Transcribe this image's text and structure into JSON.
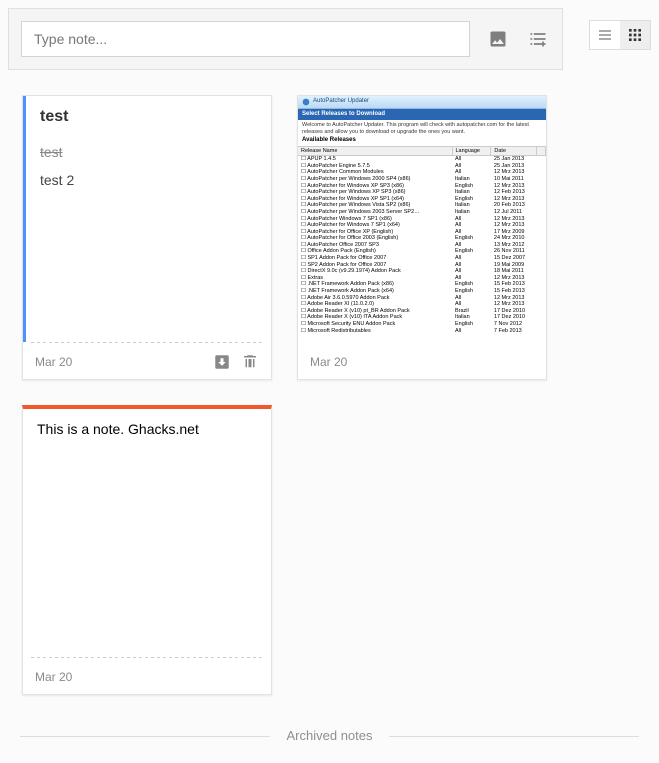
{
  "topbar": {
    "placeholder": "Type note..."
  },
  "notes": [
    {
      "title": "test",
      "done": "test",
      "pending": "test 2",
      "date": "Mar 20"
    },
    {
      "date": "Mar 20",
      "window_title": "AutoPatcher Updater",
      "bluebar": "Select Releases to Download",
      "description": "Welcome to AutoPatcher Updater. This program will check with autopatcher.com for the latest releases and allow you to download or upgrade the ones you want.",
      "available_label": "Available Releases",
      "columns": {
        "c1": "Release Name",
        "c2": "Language",
        "c3": "Date"
      },
      "rows": [
        {
          "n": "APUP 1.4.5",
          "l": "All",
          "d": "25 Jan 2013"
        },
        {
          "n": "AutoPatcher Engine 5.7.5",
          "l": "All",
          "d": "25 Jan 2013"
        },
        {
          "n": "AutoPatcher Common Modules",
          "l": "All",
          "d": "12 Mrz 2013"
        },
        {
          "n": "AutoPatcher per Windows 2000 SP4 (x86)",
          "l": "Italian",
          "d": "10 Mai 2011"
        },
        {
          "n": "AutoPatcher for Windows XP SP3 (x86)",
          "l": "English",
          "d": "12 Mrz 2013"
        },
        {
          "n": "AutoPatcher per Windows XP SP3 (x86)",
          "l": "Italian",
          "d": "12 Feb 2013"
        },
        {
          "n": "AutoPatcher for Windows XP SP1 (x64)",
          "l": "English",
          "d": "12 Mrz 2013"
        },
        {
          "n": "AutoPatcher per Windows Vista SP2 (x86)",
          "l": "Italian",
          "d": "20 Feb 2013"
        },
        {
          "n": "AutoPatcher per Windows 2003 Server SP2…",
          "l": "Italian",
          "d": "12 Jul 2011"
        },
        {
          "n": "AutoPatcher Windows 7 SP1 (x86)",
          "l": "All",
          "d": "12 Mrz 2013"
        },
        {
          "n": "AutoPatcher for Windows 7 SP1 (x64)",
          "l": "All",
          "d": "12 Mrz 2013"
        },
        {
          "n": "AutoPatcher for Office XP (English)",
          "l": "All",
          "d": "17 Mrz 2009"
        },
        {
          "n": "AutoPatcher for Office 2003 (English)",
          "l": "English",
          "d": "24 Mrz 2010"
        },
        {
          "n": "AutoPatcher Office 2007 SP3",
          "l": "All",
          "d": "13 Mrz 2012"
        },
        {
          "n": "Office Addon Pack (English)",
          "l": "English",
          "d": "26 Nov 2011"
        },
        {
          "n": "SP1 Addon Pack for Office 2007",
          "l": "All",
          "d": "15 Dez 2007"
        },
        {
          "n": "SP2 Addon Pack for Office 2007",
          "l": "All",
          "d": "19 Mai 2009"
        },
        {
          "n": "DirectX 9.0c (v9.29.1974) Addon Pack",
          "l": "All",
          "d": "18 Mai 2011"
        },
        {
          "n": "Extras",
          "l": "All",
          "d": "12 Mrz 2013"
        },
        {
          "n": ".NET Framework Addon Pack (x86)",
          "l": "English",
          "d": "15 Feb 2013"
        },
        {
          "n": ".NET Framework Addon Pack (x64)",
          "l": "English",
          "d": "15 Feb 2013"
        },
        {
          "n": "Adobe Air 3.6.0.5970 Addon Pack",
          "l": "All",
          "d": "12 Mrz 2013"
        },
        {
          "n": "Adobe Reader XI (11.0.2.0)",
          "l": "All",
          "d": "12 Mrz 2013"
        },
        {
          "n": "Adobe Reader X (v10) pt_BR Addon Pack",
          "l": "Brazil",
          "d": "17 Dez 2010"
        },
        {
          "n": "Adobe Reader X (v10) ITA Addon Pack",
          "l": "Italian",
          "d": "17 Dez 2010"
        },
        {
          "n": "Microsoft Security ENU Addon Pack",
          "l": "English",
          "d": "7 Nov 2012"
        },
        {
          "n": "Microsoft Redistributables",
          "l": "All",
          "d": "7 Feb 2013"
        }
      ]
    },
    {
      "text": "This is a note. Ghacks.net",
      "date": "Mar 20"
    }
  ],
  "archived_label": "Archived notes"
}
